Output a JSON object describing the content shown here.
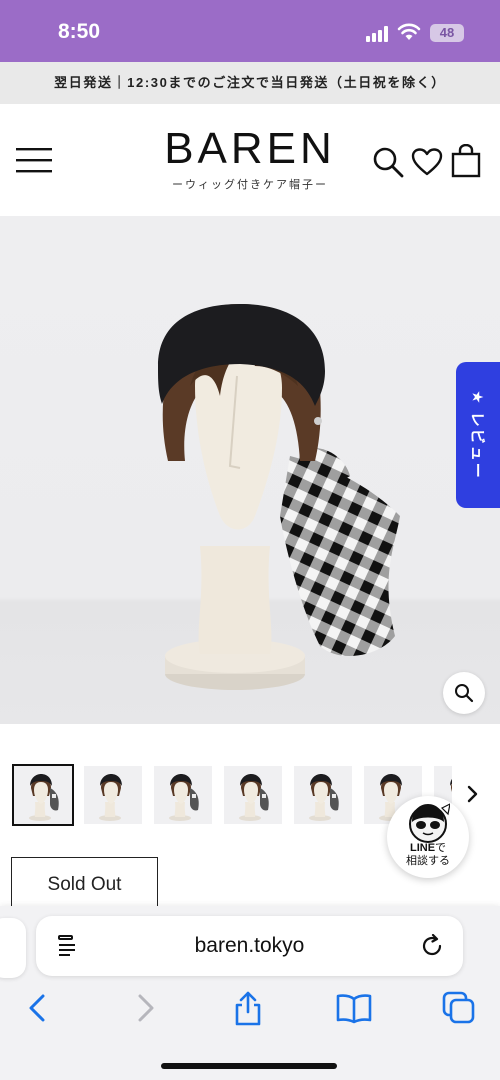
{
  "status_bar": {
    "time": "8:50",
    "battery": "48"
  },
  "announcement": {
    "text": "翌日発送｜12:30までのご注文で当日発送（土日祝を除く）"
  },
  "header": {
    "logo": "BAREN",
    "tagline": "ーウィッグ付きケア帽子ー"
  },
  "review_tab": {
    "label": "★ レビュー"
  },
  "line_widget": {
    "brand": "LINE",
    "suffix": "で",
    "line2": "相談する"
  },
  "product": {
    "sold_out_label": "Sold Out",
    "thumbnail_count": 7,
    "active_thumbnail": 1
  },
  "browser": {
    "url": "baren.tokyo"
  },
  "colors": {
    "status_bar": "#9b6cc7",
    "review_tab": "#2f3fe0",
    "ios_blue": "#1a73e8"
  }
}
